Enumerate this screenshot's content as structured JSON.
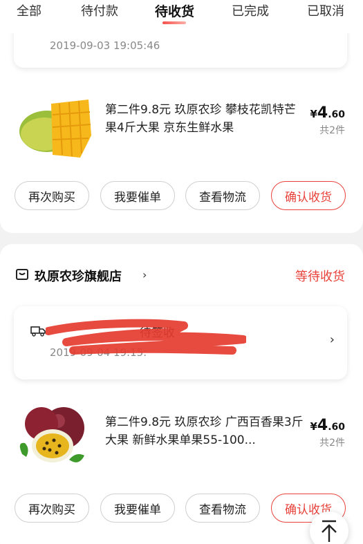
{
  "tabs": {
    "all": "全部",
    "pending_payment": "待付款",
    "pending_receipt": "待收货",
    "completed": "已完成",
    "cancelled": "已取消",
    "active": "待收货"
  },
  "orders": [
    {
      "shipping": {
        "date": "2019-09-03 19:05:46"
      },
      "product": {
        "title": "第二件9.8元 玖原农珍 攀枝花凯特芒果4斤大果 京东生鲜水果",
        "image_icon": "mango-image",
        "price_currency": "¥",
        "price_int": "4",
        "price_dec": ".60",
        "quantity": "共2件"
      },
      "buttons": {
        "buy_again": "再次购买",
        "urge": "我要催单",
        "logistics": "查看物流",
        "confirm": "确认收货"
      }
    },
    {
      "store": {
        "name": "玖原农珍旗舰店",
        "chevron": "›",
        "icon": "store-icon"
      },
      "status": "等待收货",
      "shipping": {
        "status": "待签收",
        "date": "2019-09-04 19:15:",
        "chevron": "›"
      },
      "product": {
        "title": "第二件9.8元 玖原农珍 广西百香果3斤大果 新鲜水果单果55-100...",
        "image_icon": "passion-fruit-image",
        "price_currency": "¥",
        "price_int": "4",
        "price_dec": ".60",
        "quantity": "共2件"
      },
      "buttons": {
        "buy_again": "再次购买",
        "urge": "我要催单",
        "logistics": "查看物流",
        "confirm": "确认收货"
      }
    }
  ],
  "colors": {
    "accent": "#e8413a",
    "background": "#f2f2f2",
    "card": "#ffffff"
  },
  "back_to_top_icon": "arrow-up-icon"
}
